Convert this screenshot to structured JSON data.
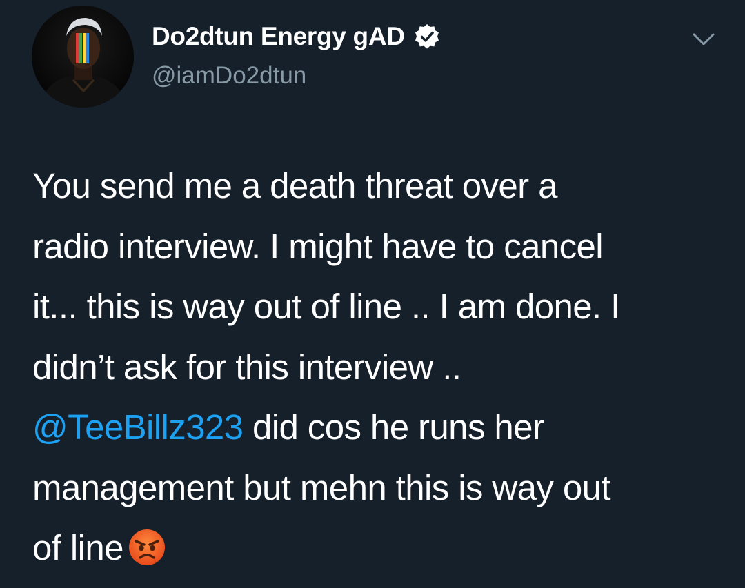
{
  "tweet": {
    "author": {
      "display_name": "Do2dtun Energy gAD",
      "handle": "@iamDo2dtun",
      "verified": true,
      "avatar_icon": "avatar-photo"
    },
    "menu_icon": "chevron-down-icon",
    "text_lines": {
      "l1": "You send me a death threat over a",
      "l2": "radio interview. I might have to cancel",
      "l3": "it... this is way out of line .. I am done. I",
      "l4": "didn’t ask for this interview ..",
      "l5_mention": "@TeeBillz323",
      "l5_rest": " did cos he runs her",
      "l6": "management but mehn this is way out",
      "l7": "of line"
    },
    "emoji": "angry-face-emoji",
    "colors": {
      "background": "#15202b",
      "text": "#ffffff",
      "secondary": "#8899a6",
      "mention": "#1da1f2"
    }
  }
}
